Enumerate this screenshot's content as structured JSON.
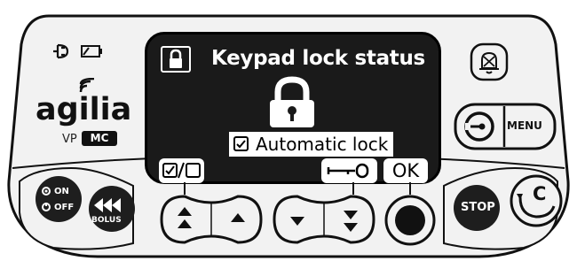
{
  "screen": {
    "title": "Keypad lock status",
    "lock_option_label": "Automatic lock",
    "lock_option_checked": true,
    "softkey_left_label": "☑/☐",
    "softkey_right_key_label": "┐—O",
    "softkey_ok_label": "OK"
  },
  "brand": {
    "logo_text": "agilia",
    "model_prefix": "VP",
    "model_badge": "MC"
  },
  "keys": {
    "menu_label": "MENU",
    "stop_label": "STOP",
    "on_label": "ON",
    "off_label": "OFF",
    "bolus_label": "BOLUS",
    "clear_label": "C"
  },
  "icons": {
    "power_plug": "plug-icon",
    "battery": "battery-icon",
    "screen_lock": "padlock-icon",
    "alarm_silence": "alarm-bell-icon",
    "info": "info-icon",
    "fast_up": "double-up-arrow-icon",
    "up": "up-arrow-icon",
    "down": "down-arrow-icon",
    "fast_down": "double-down-arrow-icon",
    "ok_dot": "select-dot-icon",
    "clear": "clear-icon"
  },
  "colors": {
    "screen_bg": "#1a1a1a",
    "key_dark": "#1e1e1e",
    "panel_bg": "#f2f2f2",
    "text_light": "#ffffff"
  }
}
